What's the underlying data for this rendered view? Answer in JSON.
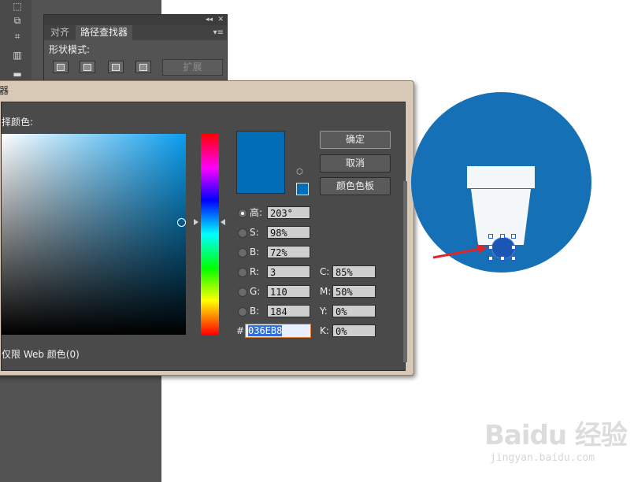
{
  "pathfinder_panel": {
    "tabs": [
      "对齐",
      "路径查找器"
    ],
    "shape_modes_label": "形状模式:",
    "expand_label": "扩展"
  },
  "color_picker": {
    "title_fragment": "器",
    "select_color_label": "择颜色:",
    "ok_label": "确定",
    "cancel_label": "取消",
    "swatches_label": "颜色色板",
    "web_only_label": "仅限 Web 颜色(0)",
    "current_color": "#036EB8",
    "fields": {
      "h_label": "高:",
      "h_value": "203°",
      "s_label": "S:",
      "s_value": "98%",
      "b_label": "B:",
      "b_value": "72%",
      "r_label": "R:",
      "r_value": "3",
      "g_label": "G:",
      "g_value": "110",
      "bl_label": "B:",
      "bl_value": "184",
      "c_label": "C:",
      "c_value": "85%",
      "m_label": "M:",
      "m_value": "50%",
      "y_label": "Y:",
      "y_value": "0%",
      "k_label": "K:",
      "k_value": "0%",
      "hex_label": "#",
      "hex_value": "036EB8"
    }
  },
  "canvas": {
    "circle_color": "#1570B5",
    "pot_color": "#F4F8FB",
    "selected_color": "#1A57B4",
    "arrow_color": "#E0242A"
  },
  "watermark": {
    "logo": "Baidu 经验",
    "url": "jingyan.baidu.com"
  }
}
